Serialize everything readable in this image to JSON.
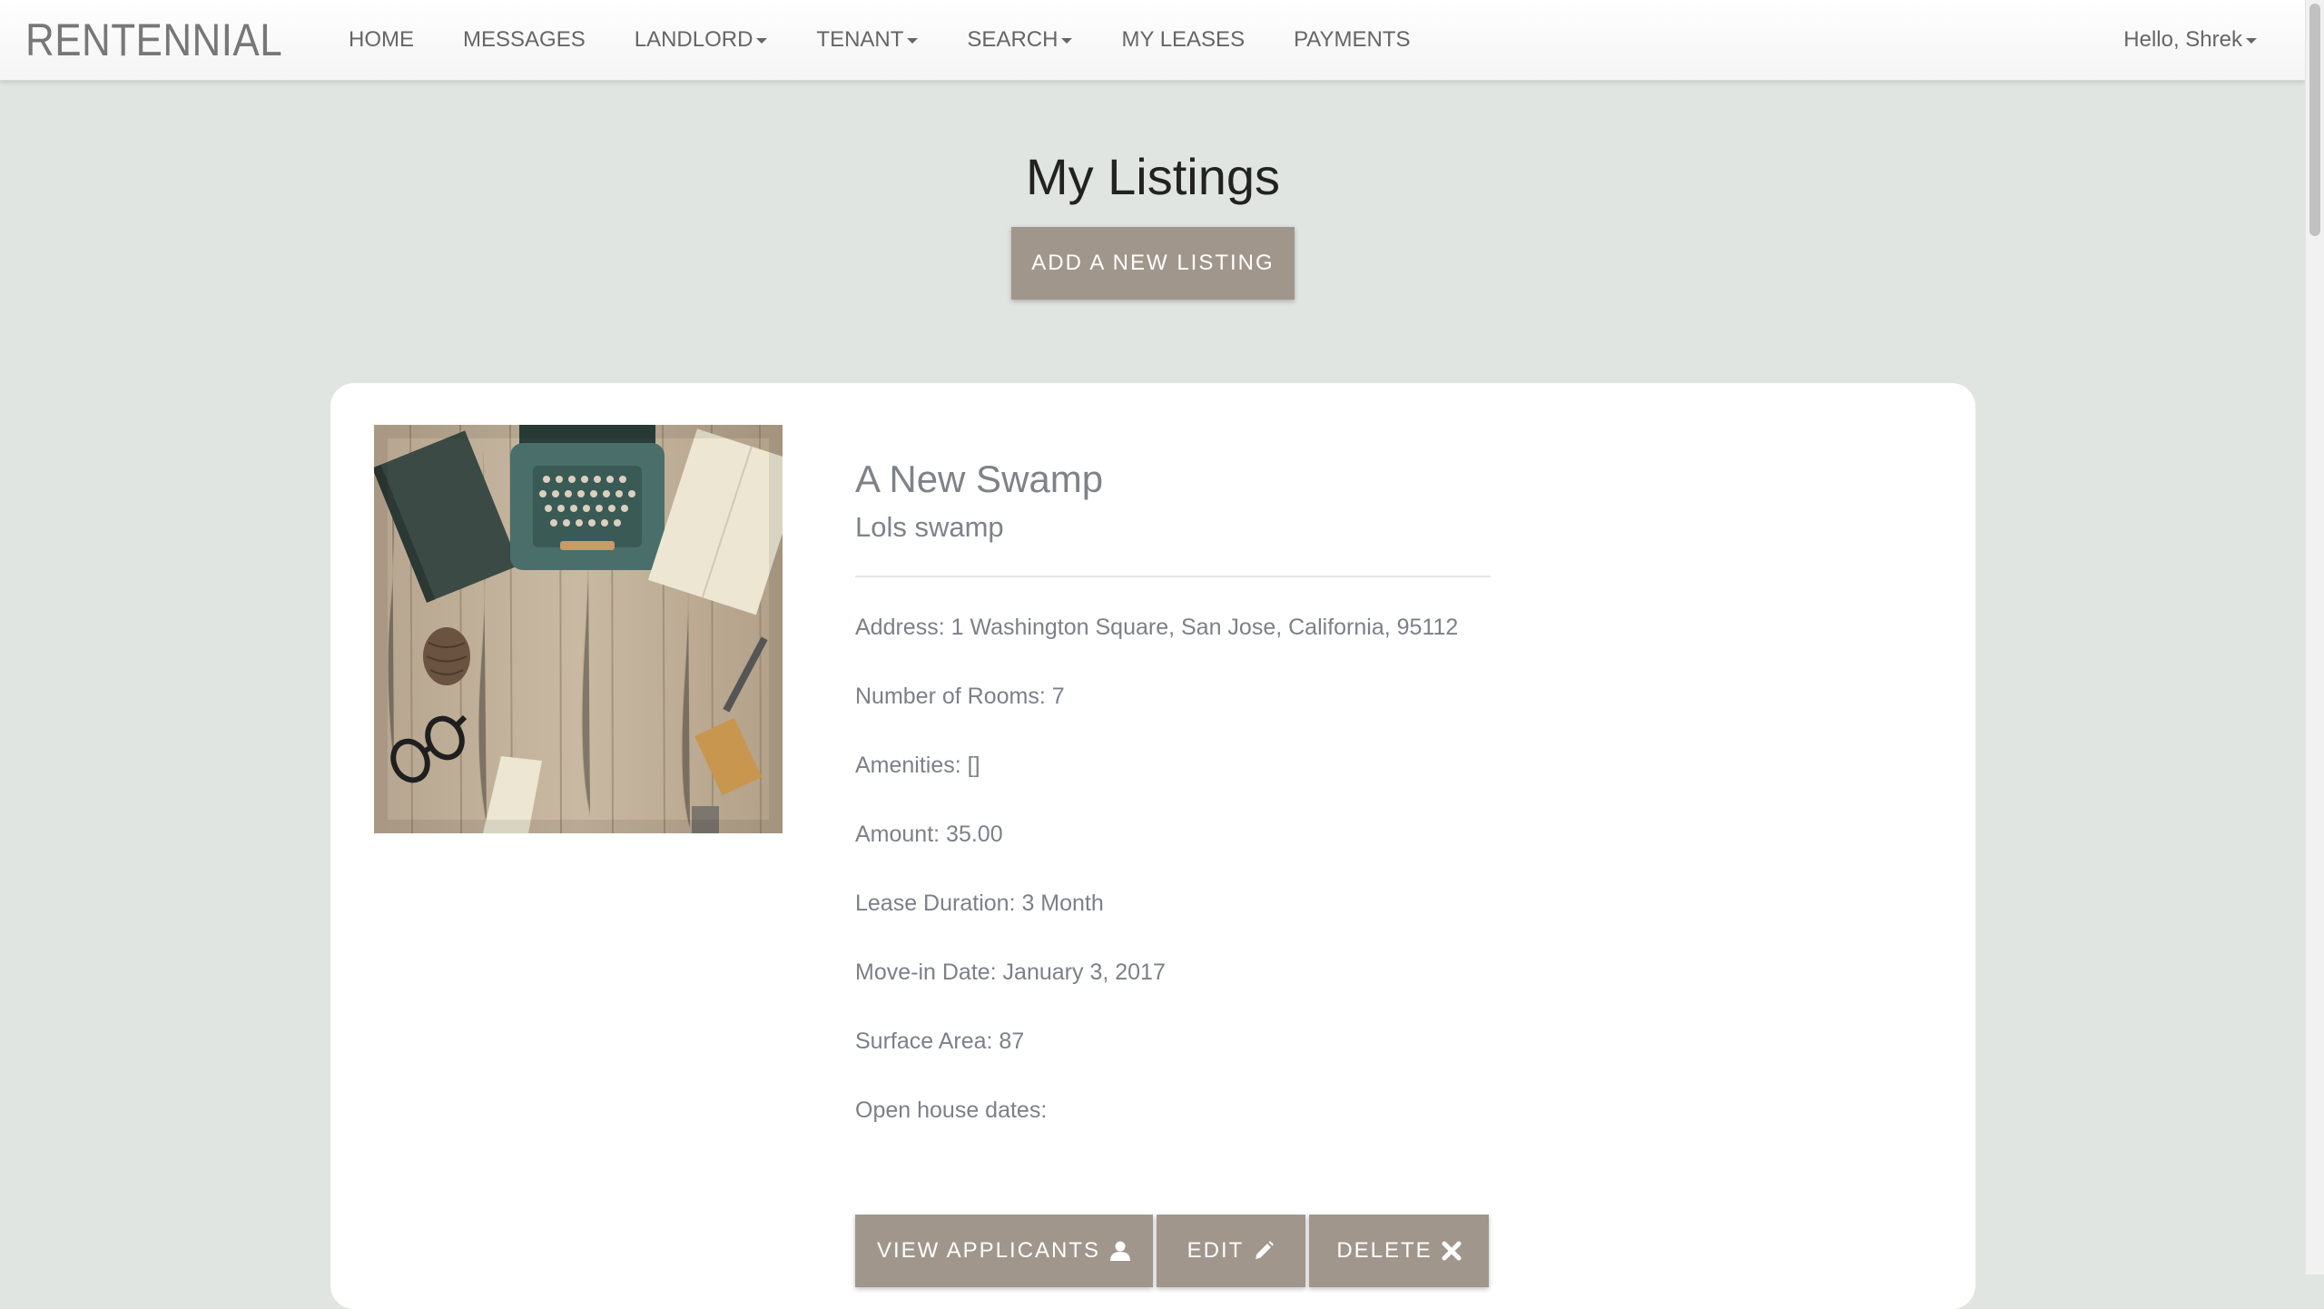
{
  "navbar": {
    "brand": "RENTENNIAL",
    "items": [
      {
        "label": "HOME",
        "dropdown": false
      },
      {
        "label": "MESSAGES",
        "dropdown": false
      },
      {
        "label": "LANDLORD",
        "dropdown": true
      },
      {
        "label": "TENANT",
        "dropdown": true
      },
      {
        "label": "SEARCH",
        "dropdown": true
      },
      {
        "label": "MY LEASES",
        "dropdown": false
      },
      {
        "label": "PAYMENTS",
        "dropdown": false
      }
    ],
    "user_greeting": "Hello, Shrek"
  },
  "page": {
    "title": "My Listings",
    "add_button": "ADD A NEW LISTING"
  },
  "listing": {
    "title": "A New Swamp",
    "subtitle": "Lols swamp",
    "address": "Address: 1 Washington Square, San Jose, California, 95112",
    "rooms": "Number of Rooms: 7",
    "amenities": "Amenities: []",
    "amount": "Amount: 35.00",
    "lease_duration": "Lease Duration: 3 Month",
    "move_in": "Move-in Date: January 3, 2017",
    "surface_area": "Surface Area: 87",
    "open_house": "Open house dates:",
    "actions": {
      "view_applicants": "VIEW APPLICANTS",
      "edit": "EDIT",
      "delete": "DELETE"
    }
  },
  "icons": {
    "view_applicants": "user-icon",
    "edit": "pencil-icon",
    "delete": "close-icon"
  },
  "colors": {
    "background": "#e1e5e1",
    "button": "#a1968c",
    "card": "#ffffff",
    "field_text": "#7c8087"
  }
}
